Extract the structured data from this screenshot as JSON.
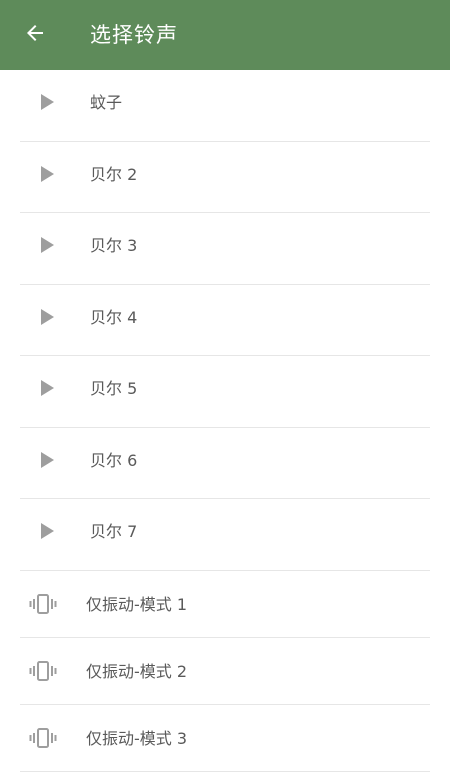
{
  "header": {
    "title": "选择铃声",
    "back_icon": "arrow-left-icon",
    "background": "#5e8b5a"
  },
  "ringtones": [
    {
      "label": "蚊子",
      "icon": "play-icon"
    },
    {
      "label": "贝尔 2",
      "icon": "play-icon"
    },
    {
      "label": "贝尔 3",
      "icon": "play-icon"
    },
    {
      "label": "贝尔 4",
      "icon": "play-icon"
    },
    {
      "label": "贝尔 5",
      "icon": "play-icon"
    },
    {
      "label": "贝尔 6",
      "icon": "play-icon"
    },
    {
      "label": "贝尔 7",
      "icon": "play-icon"
    }
  ],
  "vibration_modes": [
    {
      "label": "仅振动-模式 1",
      "icon": "vibrate-icon"
    },
    {
      "label": "仅振动-模式 2",
      "icon": "vibrate-icon"
    },
    {
      "label": "仅振动-模式 3",
      "icon": "vibrate-icon"
    }
  ]
}
